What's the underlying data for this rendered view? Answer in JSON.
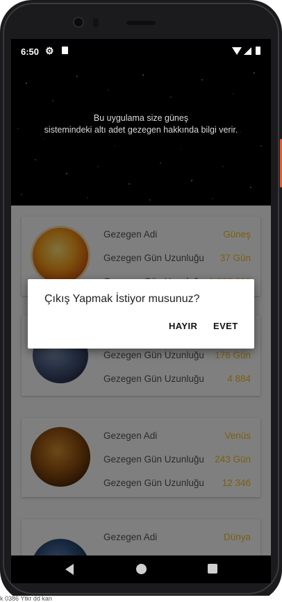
{
  "status_bar": {
    "time": "6:50"
  },
  "header": {
    "line1": "Bu uygulama size güneş",
    "line2": "sistemindeki altı adet gezegen hakkında bilgi verir."
  },
  "planets": [
    {
      "rows": [
        {
          "label": "Gezegen Adi",
          "value": "Güneş"
        },
        {
          "label": "Gezegen Gün Uzunluğu",
          "value": "37 Gün"
        },
        {
          "label": "Gezegen Gün Uzunluğu",
          "value": "1.392.000"
        }
      ]
    },
    {
      "rows": [
        {
          "label": "Gezegen Gün Uzunluğu",
          "value": "176 Gün"
        },
        {
          "label": "Gezegen Gün Uzunluğu",
          "value": "4 884"
        }
      ]
    },
    {
      "rows": [
        {
          "label": "Gezegen Adi",
          "value": "Venüs"
        },
        {
          "label": "Gezegen Gün Uzunluğu",
          "value": "243 Gün"
        },
        {
          "label": "Gezegen Gün Uzunluğu",
          "value": "12 346"
        }
      ]
    },
    {
      "rows": [
        {
          "label": "Gezegen Adi",
          "value": "Dünya"
        }
      ]
    }
  ],
  "dialog": {
    "title": "Çıkış Yapmak İstiyor musunuz?",
    "negative": "HAYIR",
    "positive": "EVET"
  },
  "bottom_text": "k 0386 Ytkr dd kan",
  "colors": {
    "accent": "#f5c020",
    "label": "#555555",
    "overlay": "rgba(0,0,0,0.5)"
  },
  "icons": [
    "settings-gear-icon",
    "sd-card-icon",
    "wifi-icon",
    "cell-signal-icon",
    "battery-icon",
    "nav-back-icon",
    "nav-home-icon",
    "nav-recents-icon"
  ]
}
